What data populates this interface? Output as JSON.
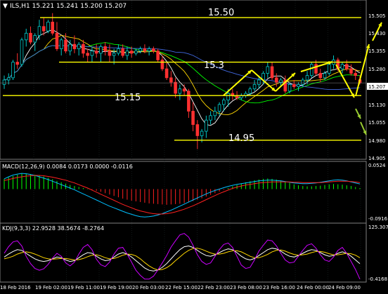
{
  "header": {
    "symbol_label": "ILS,H1  15.221 15.241 15.200 15.207"
  },
  "macd_label": "MACD(12,26,9) 0.0084 0.0173 0.0000 -0.0116",
  "kdj_label": "KDJ(9,3,3) 22.9528 38.5674 -8.2764",
  "level_labels": [
    "15.50",
    "15.3",
    "15.15",
    "14.95"
  ],
  "price_axis": {
    "ticks": [
      "15.505",
      "15.430",
      "15.355",
      "15.280",
      "15.130",
      "15.055",
      "14.980",
      "14.905"
    ],
    "current_price": "15.207"
  },
  "macd_axis": {
    "ticks": [
      "0.0524",
      "-0.0916"
    ]
  },
  "kdj_axis": {
    "ticks": [
      "125.3072",
      "-0.4168"
    ]
  },
  "time_axis": [
    "18 Feb 2016",
    "19 Feb 02:00",
    "19 Feb 11:00",
    "19 Feb 19:00",
    "20 Feb 03:00",
    "22 Feb 15:00",
    "22 Feb 23:00",
    "23 Feb 08:00",
    "23 Feb 16:00",
    "24 Feb 00:00",
    "24 Feb 09:00"
  ],
  "colors": {
    "background": "#000000",
    "grid": "#1e2a2a",
    "bull_candle": "#00c8c8",
    "bear_candle": "#ff3030",
    "level_line": "#ffff00",
    "annotation_arrow": "#ffff00",
    "future_arrow": "#9acd32",
    "ma_fast": "#ffffff",
    "ma_mid": "#ffd700",
    "ma_slow": "#00ff00",
    "ma_long": "#4169e1",
    "macd_line": "#00bfff",
    "signal_line": "#ff2020",
    "macd_hist_pos": "#00ff00",
    "macd_hist_neg": "#ff2020",
    "kdj_k": "#ffffff",
    "kdj_d": "#ffd700",
    "kdj_j": "#cc00ff",
    "text": "#ffffff"
  },
  "chart_data": [
    {
      "type": "candlestick",
      "title": "ILS,H1",
      "last_bar": {
        "open": 15.221,
        "high": 15.241,
        "low": 15.2,
        "close": 15.207
      },
      "ylim": [
        14.88,
        15.56
      ],
      "horizontal_levels": [
        15.5,
        15.3,
        15.15,
        14.95
      ],
      "candles": [
        [
          15.2,
          15.24,
          15.18,
          15.22
        ],
        [
          15.22,
          15.25,
          15.2,
          15.23
        ],
        [
          15.23,
          15.31,
          15.22,
          15.3
        ],
        [
          15.3,
          15.34,
          15.27,
          15.29
        ],
        [
          15.29,
          15.41,
          15.28,
          15.4
        ],
        [
          15.4,
          15.45,
          15.37,
          15.43
        ],
        [
          15.43,
          15.46,
          15.38,
          15.39
        ],
        [
          15.39,
          15.43,
          15.35,
          15.42
        ],
        [
          15.42,
          15.49,
          15.4,
          15.46
        ],
        [
          15.46,
          15.5,
          15.42,
          15.44
        ],
        [
          15.44,
          15.49,
          15.43,
          15.48
        ],
        [
          15.48,
          15.52,
          15.42,
          15.43
        ],
        [
          15.43,
          15.48,
          15.35,
          15.36
        ],
        [
          15.36,
          15.41,
          15.33,
          15.4
        ],
        [
          15.4,
          15.43,
          15.34,
          15.35
        ],
        [
          15.35,
          15.4,
          15.33,
          15.38
        ],
        [
          15.38,
          15.42,
          15.34,
          15.36
        ],
        [
          15.36,
          15.39,
          15.33,
          15.38
        ],
        [
          15.38,
          15.4,
          15.32,
          15.34
        ],
        [
          15.34,
          15.36,
          15.3,
          15.33
        ],
        [
          15.33,
          15.37,
          15.3,
          15.35
        ],
        [
          15.35,
          15.38,
          15.32,
          15.34
        ],
        [
          15.34,
          15.38,
          15.3,
          15.37
        ],
        [
          15.37,
          15.39,
          15.33,
          15.35
        ],
        [
          15.35,
          15.38,
          15.3,
          15.33
        ],
        [
          15.33,
          15.36,
          15.29,
          15.34
        ],
        [
          15.34,
          15.38,
          15.33,
          15.36
        ],
        [
          15.36,
          15.38,
          15.32,
          15.33
        ],
        [
          15.33,
          15.37,
          15.31,
          15.35
        ],
        [
          15.35,
          15.37,
          15.32,
          15.34
        ],
        [
          15.34,
          15.36,
          15.33,
          15.35
        ],
        [
          15.35,
          15.37,
          15.34,
          15.36
        ],
        [
          15.36,
          15.38,
          15.34,
          15.35
        ],
        [
          15.35,
          15.37,
          15.33,
          15.36
        ],
        [
          15.36,
          15.37,
          15.34,
          15.35
        ],
        [
          15.35,
          15.36,
          15.3,
          15.31
        ],
        [
          15.31,
          15.33,
          15.26,
          15.27
        ],
        [
          15.27,
          15.3,
          15.22,
          15.23
        ],
        [
          15.23,
          15.26,
          15.19,
          15.21
        ],
        [
          15.21,
          15.23,
          15.14,
          15.16
        ],
        [
          15.16,
          15.2,
          15.13,
          15.18
        ],
        [
          15.18,
          15.2,
          15.15,
          15.17
        ],
        [
          15.17,
          15.18,
          15.05,
          15.08
        ],
        [
          15.08,
          15.12,
          14.99,
          15.02
        ],
        [
          15.02,
          15.04,
          14.91,
          14.97
        ],
        [
          14.97,
          15.0,
          14.94,
          14.99
        ],
        [
          14.99,
          15.06,
          14.96,
          15.04
        ],
        [
          15.04,
          15.08,
          15.02,
          15.06
        ],
        [
          15.06,
          15.1,
          15.04,
          15.08
        ],
        [
          15.08,
          15.12,
          15.06,
          15.11
        ],
        [
          15.11,
          15.14,
          15.08,
          15.13
        ],
        [
          15.13,
          15.18,
          15.1,
          15.16
        ],
        [
          15.16,
          15.18,
          15.13,
          15.15
        ],
        [
          15.15,
          15.17,
          15.13,
          15.14
        ],
        [
          15.14,
          15.16,
          15.13,
          15.15
        ],
        [
          15.15,
          15.17,
          15.14,
          15.16
        ],
        [
          15.16,
          15.19,
          15.15,
          15.18
        ],
        [
          15.18,
          15.22,
          15.17,
          15.2
        ],
        [
          15.2,
          15.24,
          15.18,
          15.22
        ],
        [
          15.22,
          15.26,
          15.2,
          15.25
        ],
        [
          15.25,
          15.3,
          15.23,
          15.28
        ],
        [
          15.28,
          15.3,
          15.22,
          15.23
        ],
        [
          15.23,
          15.25,
          15.19,
          15.21
        ],
        [
          15.21,
          15.23,
          15.19,
          15.22
        ],
        [
          15.22,
          15.24,
          15.16,
          15.17
        ],
        [
          15.17,
          15.21,
          15.16,
          15.2
        ],
        [
          15.2,
          15.22,
          15.18,
          15.19
        ],
        [
          15.19,
          15.21,
          15.17,
          15.2
        ],
        [
          15.2,
          15.23,
          15.19,
          15.22
        ],
        [
          15.22,
          15.26,
          15.2,
          15.24
        ],
        [
          15.24,
          15.3,
          15.23,
          15.29
        ],
        [
          15.29,
          15.31,
          15.24,
          15.25
        ],
        [
          15.25,
          15.27,
          15.21,
          15.23
        ],
        [
          15.23,
          15.26,
          15.22,
          15.25
        ],
        [
          15.25,
          15.3,
          15.24,
          15.29
        ],
        [
          15.29,
          15.33,
          15.27,
          15.31
        ],
        [
          15.31,
          15.32,
          15.26,
          15.27
        ],
        [
          15.27,
          15.3,
          15.25,
          15.29
        ],
        [
          15.29,
          15.31,
          15.26,
          15.27
        ],
        [
          15.27,
          15.29,
          15.24,
          15.25
        ],
        [
          15.25,
          15.27,
          15.22,
          15.24
        ],
        [
          15.221,
          15.241,
          15.2,
          15.207
        ]
      ]
    },
    {
      "type": "macd",
      "title": "MACD(12,26,9)",
      "values": [
        0.0084,
        0.0173,
        0.0,
        -0.0116
      ],
      "ylim": [
        -0.0916,
        0.0524
      ],
      "histogram": [
        0.03,
        0.034,
        0.038,
        0.042,
        0.045,
        0.046,
        0.044,
        0.042,
        0.04,
        0.037,
        0.033,
        0.029,
        0.024,
        0.02,
        0.016,
        0.012,
        0.009,
        0.006,
        0.003,
        0.001,
        -0.002,
        -0.005,
        -0.008,
        -0.012,
        -0.016,
        -0.02,
        -0.024,
        -0.028,
        -0.031,
        -0.034,
        -0.036,
        -0.038,
        -0.04,
        -0.042,
        -0.043,
        -0.044,
        -0.045,
        -0.046,
        -0.045,
        -0.044,
        -0.043,
        -0.041,
        -0.038,
        -0.035,
        -0.031,
        -0.027,
        -0.022,
        -0.017,
        -0.012,
        -0.007,
        -0.002,
        0.003,
        0.008,
        0.012,
        0.016,
        0.02,
        0.023,
        0.026,
        0.028,
        0.03,
        0.031,
        0.03,
        0.028,
        0.025,
        0.022,
        0.018,
        0.014,
        0.011,
        0.009,
        0.008,
        0.008,
        0.009,
        0.01,
        0.012,
        0.014,
        0.015,
        0.014,
        0.013,
        0.011,
        0.009,
        0.006,
        0.003
      ],
      "macd_line": [
        0.03,
        0.036,
        0.041,
        0.044,
        0.046,
        0.045,
        0.043,
        0.04,
        0.036,
        0.032,
        0.028,
        0.023,
        0.018,
        0.013,
        0.008,
        0.003,
        -0.002,
        -0.008,
        -0.014,
        -0.02,
        -0.026,
        -0.032,
        -0.038,
        -0.044,
        -0.05,
        -0.055,
        -0.06,
        -0.065,
        -0.07,
        -0.074,
        -0.078,
        -0.081,
        -0.082,
        -0.081,
        -0.079,
        -0.076,
        -0.072,
        -0.067,
        -0.062,
        -0.056,
        -0.05,
        -0.044,
        -0.038,
        -0.032,
        -0.026,
        -0.02,
        -0.014,
        -0.009,
        -0.004,
        0.0,
        0.004,
        0.008,
        0.011,
        0.014,
        0.016,
        0.018,
        0.02,
        0.022,
        0.024,
        0.025,
        0.026,
        0.026,
        0.025,
        0.024,
        0.022,
        0.02,
        0.018,
        0.017,
        0.016,
        0.016,
        0.017,
        0.018,
        0.02,
        0.022,
        0.024,
        0.026,
        0.027,
        0.026,
        0.024,
        0.021,
        0.018,
        0.015
      ],
      "signal_line": [
        0.025,
        0.028,
        0.031,
        0.034,
        0.036,
        0.038,
        0.039,
        0.04,
        0.04,
        0.039,
        0.037,
        0.035,
        0.032,
        0.029,
        0.026,
        0.022,
        0.018,
        0.013,
        0.008,
        0.003,
        -0.003,
        -0.009,
        -0.015,
        -0.021,
        -0.027,
        -0.033,
        -0.039,
        -0.045,
        -0.05,
        -0.055,
        -0.06,
        -0.064,
        -0.067,
        -0.07,
        -0.072,
        -0.073,
        -0.073,
        -0.072,
        -0.07,
        -0.067,
        -0.063,
        -0.059,
        -0.054,
        -0.049,
        -0.043,
        -0.037,
        -0.031,
        -0.025,
        -0.019,
        -0.013,
        -0.008,
        -0.003,
        0.002,
        0.006,
        0.009,
        0.012,
        0.014,
        0.016,
        0.018,
        0.019,
        0.02,
        0.021,
        0.021,
        0.021,
        0.021,
        0.021,
        0.02,
        0.02,
        0.019,
        0.019,
        0.019,
        0.019,
        0.019,
        0.02,
        0.021,
        0.022,
        0.023,
        0.023,
        0.023,
        0.022,
        0.021,
        0.019
      ]
    },
    {
      "type": "kdj",
      "title": "KDJ(9,3,3)",
      "values": [
        22.9528,
        38.5674,
        -8.2764
      ],
      "ylim": [
        -0.4168,
        125.3072
      ],
      "k": [
        60,
        68,
        75,
        80,
        78,
        70,
        62,
        55,
        50,
        48,
        50,
        55,
        60,
        58,
        52,
        48,
        50,
        58,
        66,
        72,
        70,
        62,
        55,
        50,
        52,
        60,
        68,
        72,
        68,
        60,
        50,
        40,
        30,
        24,
        22,
        25,
        32,
        42,
        55,
        68,
        80,
        88,
        90,
        86,
        78,
        70,
        64,
        62,
        66,
        72,
        78,
        82,
        80,
        72,
        62,
        55,
        52,
        56,
        64,
        72,
        80,
        84,
        82,
        76,
        68,
        62,
        60,
        64,
        70,
        76,
        80,
        78,
        72,
        66,
        62,
        64,
        70,
        74,
        70,
        62,
        52,
        42
      ],
      "d": [
        55,
        58,
        62,
        68,
        72,
        74,
        72,
        68,
        63,
        58,
        55,
        54,
        55,
        56,
        56,
        54,
        52,
        53,
        56,
        61,
        65,
        66,
        63,
        58,
        55,
        56,
        60,
        65,
        68,
        67,
        63,
        55,
        45,
        36,
        29,
        25,
        26,
        31,
        39,
        50,
        60,
        70,
        78,
        83,
        84,
        81,
        76,
        71,
        68,
        68,
        70,
        74,
        77,
        77,
        74,
        68,
        62,
        58,
        58,
        62,
        67,
        74,
        78,
        79,
        76,
        71,
        67,
        65,
        66,
        68,
        72,
        75,
        75,
        73,
        69,
        66,
        66,
        68,
        70,
        69,
        65,
        58
      ],
      "j": [
        70,
        88,
        101,
        104,
        90,
        62,
        42,
        29,
        24,
        28,
        40,
        57,
        70,
        62,
        44,
        36,
        46,
        68,
        86,
        94,
        80,
        54,
        39,
        34,
        46,
        68,
        84,
        86,
        68,
        46,
        24,
        10,
        0,
        0,
        8,
        25,
        44,
        64,
        87,
        104,
        120,
        124,
        114,
        92,
        66,
        48,
        40,
        44,
        62,
        80,
        94,
        98,
        86,
        62,
        38,
        29,
        32,
        52,
        76,
        92,
        106,
        104,
        90,
        70,
        52,
        44,
        46,
        62,
        78,
        92,
        96,
        84,
        66,
        52,
        48,
        60,
        78,
        86,
        70,
        48,
        26,
        0
      ]
    }
  ]
}
